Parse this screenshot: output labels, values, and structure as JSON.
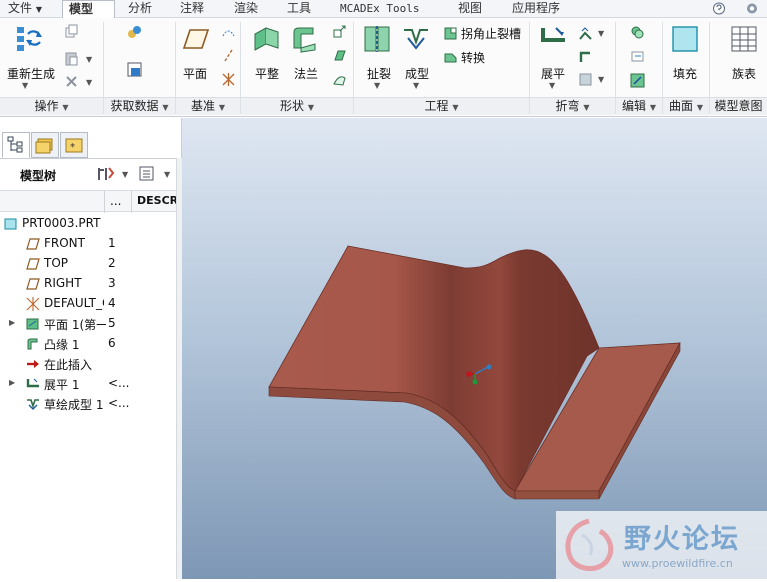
{
  "menu": {
    "file": "文件",
    "tabs": [
      "模型",
      "分析",
      "注释",
      "渲染",
      "工具",
      "MCADEx Tools",
      "视图",
      "应用程序"
    ],
    "active_tab": "模型"
  },
  "ribbon": {
    "regenerate": "重新生成",
    "plane": "平面",
    "flat": "平整",
    "flange": "法兰",
    "rip": "扯裂",
    "form": "成型",
    "corner_relief": "拐角止裂槽",
    "convert": "转换",
    "unbend": "展平",
    "fill": "填充",
    "family_table": "族表",
    "groups": [
      "操作",
      "获取数据",
      "基准",
      "形状",
      "工程",
      "折弯",
      "编辑",
      "曲面",
      "模型意图"
    ]
  },
  "left_panel": {
    "model_tree_label": "模型树",
    "columns": [
      "...",
      "DESCR"
    ],
    "root": "PRT0003.PRT",
    "items": [
      {
        "name": "FRONT",
        "num": "1",
        "icon": "datum-plane-icon"
      },
      {
        "name": "TOP",
        "num": "2",
        "icon": "datum-plane-icon"
      },
      {
        "name": "RIGHT",
        "num": "3",
        "icon": "datum-plane-icon"
      },
      {
        "name": "DEFAULT_C",
        "num": "4",
        "icon": "coordinate-system-icon"
      },
      {
        "name": "平面 1(第一",
        "num": "5",
        "icon": "flat-wall-icon",
        "expandable": true
      },
      {
        "name": "凸缘 1",
        "num": "6",
        "icon": "flange-icon"
      },
      {
        "name": "在此插入",
        "num": "",
        "icon": "insert-arrow-icon"
      },
      {
        "name": "展平 1",
        "num": "<...",
        "icon": "unbend-icon",
        "expandable": true
      },
      {
        "name": "草绘成型 1",
        "num": "<...",
        "icon": "sketched-form-icon"
      }
    ]
  },
  "watermark": {
    "title": "野火论坛",
    "url": "www.proewildfire.cn"
  },
  "colors": {
    "part": "#a85a4c",
    "part_dark": "#7d3c33",
    "viewport_top": "#dfe7f2",
    "viewport_bottom": "#7e97b5",
    "accent": "#2a7fc7"
  }
}
